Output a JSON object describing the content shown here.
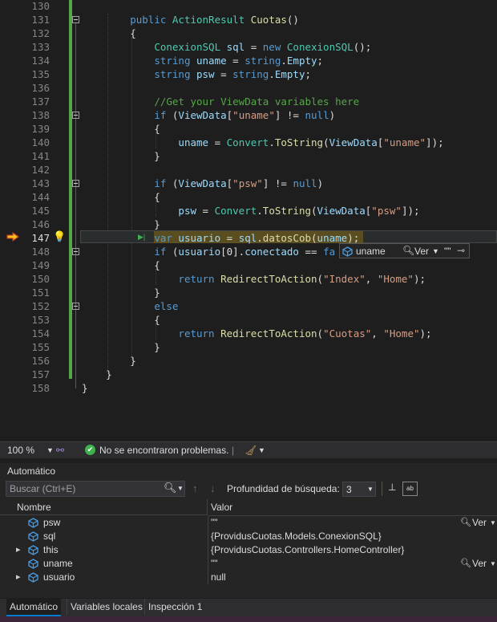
{
  "editor": {
    "lines": [
      {
        "n": "130",
        "tokens": []
      },
      {
        "n": "131",
        "tokens": [
          [
            "",
            "        "
          ],
          [
            "kw",
            "public "
          ],
          [
            "ty",
            "ActionResult "
          ],
          [
            "fn",
            "Cuotas"
          ],
          [
            "",
            "()"
          ]
        ]
      },
      {
        "n": "132",
        "tokens": [
          [
            "",
            "        {"
          ]
        ]
      },
      {
        "n": "133",
        "tokens": [
          [
            "",
            "            "
          ],
          [
            "ty",
            "ConexionSQL "
          ],
          [
            "vr",
            "sql"
          ],
          [
            "",
            " = "
          ],
          [
            "kw",
            "new "
          ],
          [
            "ty",
            "ConexionSQL"
          ],
          [
            "",
            "();"
          ]
        ]
      },
      {
        "n": "134",
        "tokens": [
          [
            "",
            "            "
          ],
          [
            "kw",
            "string "
          ],
          [
            "vr",
            "uname"
          ],
          [
            "",
            " = "
          ],
          [
            "kw",
            "string"
          ],
          [
            "",
            "."
          ],
          [
            "vr",
            "Empty"
          ],
          [
            "",
            ";"
          ]
        ]
      },
      {
        "n": "135",
        "tokens": [
          [
            "",
            "            "
          ],
          [
            "kw",
            "string "
          ],
          [
            "vr",
            "psw"
          ],
          [
            "",
            " = "
          ],
          [
            "kw",
            "string"
          ],
          [
            "",
            "."
          ],
          [
            "vr",
            "Empty"
          ],
          [
            "",
            ";"
          ]
        ]
      },
      {
        "n": "136",
        "tokens": []
      },
      {
        "n": "137",
        "tokens": [
          [
            "",
            "            "
          ],
          [
            "cm",
            "//Get your ViewData variables here"
          ]
        ]
      },
      {
        "n": "138",
        "tokens": [
          [
            "",
            "            "
          ],
          [
            "kw",
            "if "
          ],
          [
            "",
            "("
          ],
          [
            "vr",
            "ViewData"
          ],
          [
            "",
            "["
          ],
          [
            "st",
            "\"uname\""
          ],
          [
            "",
            "] != "
          ],
          [
            "kw",
            "null"
          ],
          [
            "",
            ")"
          ]
        ]
      },
      {
        "n": "139",
        "tokens": [
          [
            "",
            "            {"
          ]
        ]
      },
      {
        "n": "140",
        "tokens": [
          [
            "",
            "                "
          ],
          [
            "vr",
            "uname"
          ],
          [
            "",
            " = "
          ],
          [
            "ty",
            "Convert"
          ],
          [
            "",
            "."
          ],
          [
            "fn",
            "ToString"
          ],
          [
            "",
            "("
          ],
          [
            "vr",
            "ViewData"
          ],
          [
            "",
            "["
          ],
          [
            "st",
            "\"uname\""
          ],
          [
            "",
            "]);"
          ]
        ]
      },
      {
        "n": "141",
        "tokens": [
          [
            "",
            "            }"
          ]
        ]
      },
      {
        "n": "142",
        "tokens": []
      },
      {
        "n": "143",
        "tokens": [
          [
            "",
            "            "
          ],
          [
            "kw",
            "if "
          ],
          [
            "",
            "("
          ],
          [
            "vr",
            "ViewData"
          ],
          [
            "",
            "["
          ],
          [
            "st",
            "\"psw\""
          ],
          [
            "",
            "] != "
          ],
          [
            "kw",
            "null"
          ],
          [
            "",
            ")"
          ]
        ]
      },
      {
        "n": "144",
        "tokens": [
          [
            "",
            "            {"
          ]
        ]
      },
      {
        "n": "145",
        "tokens": [
          [
            "",
            "                "
          ],
          [
            "vr",
            "psw"
          ],
          [
            "",
            " = "
          ],
          [
            "ty",
            "Convert"
          ],
          [
            "",
            "."
          ],
          [
            "fn",
            "ToString"
          ],
          [
            "",
            "("
          ],
          [
            "vr",
            "ViewData"
          ],
          [
            "",
            "["
          ],
          [
            "st",
            "\"psw\""
          ],
          [
            "",
            "]);"
          ]
        ]
      },
      {
        "n": "146",
        "tokens": [
          [
            "",
            "            }"
          ]
        ]
      },
      {
        "n": "147",
        "tokens": [
          [
            "",
            "            "
          ],
          [
            "kw",
            "var "
          ],
          [
            "vr",
            "usuario"
          ],
          [
            "",
            " = "
          ],
          [
            "vr",
            "sql"
          ],
          [
            "",
            "."
          ],
          [
            "fn",
            "datosCob"
          ],
          [
            "",
            "("
          ],
          [
            "vr",
            "uname"
          ],
          [
            "",
            ");"
          ]
        ]
      },
      {
        "n": "148",
        "tokens": [
          [
            "",
            "            "
          ],
          [
            "kw",
            "if "
          ],
          [
            "",
            "("
          ],
          [
            "vr",
            "usuario"
          ],
          [
            "",
            "[0]."
          ],
          [
            "vr",
            "conectado"
          ],
          [
            "",
            " == "
          ],
          [
            "kw",
            "fa"
          ]
        ]
      },
      {
        "n": "149",
        "tokens": [
          [
            "",
            "            {"
          ]
        ]
      },
      {
        "n": "150",
        "tokens": [
          [
            "",
            "                "
          ],
          [
            "kw",
            "return "
          ],
          [
            "fn",
            "RedirectToAction"
          ],
          [
            "",
            "("
          ],
          [
            "st",
            "\"Index\""
          ],
          [
            "",
            ", "
          ],
          [
            "st",
            "\"Home\""
          ],
          [
            "",
            ");"
          ]
        ]
      },
      {
        "n": "151",
        "tokens": [
          [
            "",
            "            }"
          ]
        ]
      },
      {
        "n": "152",
        "tokens": [
          [
            "",
            "            "
          ],
          [
            "kw",
            "else"
          ]
        ]
      },
      {
        "n": "153",
        "tokens": [
          [
            "",
            "            {"
          ]
        ]
      },
      {
        "n": "154",
        "tokens": [
          [
            "",
            "                "
          ],
          [
            "kw",
            "return "
          ],
          [
            "fn",
            "RedirectToAction"
          ],
          [
            "",
            "("
          ],
          [
            "st",
            "\"Cuotas\""
          ],
          [
            "",
            ", "
          ],
          [
            "st",
            "\"Home\""
          ],
          [
            "",
            ");"
          ]
        ]
      },
      {
        "n": "155",
        "tokens": [
          [
            "",
            "            }"
          ]
        ]
      },
      {
        "n": "156",
        "tokens": [
          [
            "",
            "        }"
          ]
        ]
      },
      {
        "n": "157",
        "tokens": [
          [
            "",
            "    }"
          ]
        ]
      },
      {
        "n": "158",
        "tokens": [
          [
            "",
            "}"
          ]
        ]
      }
    ],
    "current_line": "147",
    "datatip": {
      "name": "uname",
      "view_label": "Ver",
      "value": "\"\""
    }
  },
  "status": {
    "zoom": "100 %",
    "message": "No se encontraron problemas."
  },
  "autos": {
    "title": "Automático",
    "search_placeholder": "Buscar (Ctrl+E)",
    "depth_label": "Profundidad de búsqueda:",
    "depth_value": "3",
    "col_name": "Nombre",
    "col_value": "Valor",
    "view_label": "Ver",
    "rows": [
      {
        "name": "psw",
        "value": "\"\"",
        "expandable": false,
        "has_view": true
      },
      {
        "name": "sql",
        "value": "{ProvidusCuotas.Models.ConexionSQL}",
        "expandable": false,
        "has_view": false
      },
      {
        "name": "this",
        "value": "{ProvidusCuotas.Controllers.HomeController}",
        "expandable": true,
        "has_view": false
      },
      {
        "name": "uname",
        "value": "\"\"",
        "expandable": false,
        "has_view": true
      },
      {
        "name": "usuario",
        "value": "null",
        "expandable": true,
        "has_view": false
      }
    ]
  },
  "tabs": [
    "Automático",
    "Variables locales",
    "Inspección 1"
  ],
  "colors": {
    "accent": "#007acc",
    "keyword": "#569cd6",
    "type": "#4ec9b0",
    "string": "#d69d85",
    "comment": "#57a64a"
  }
}
